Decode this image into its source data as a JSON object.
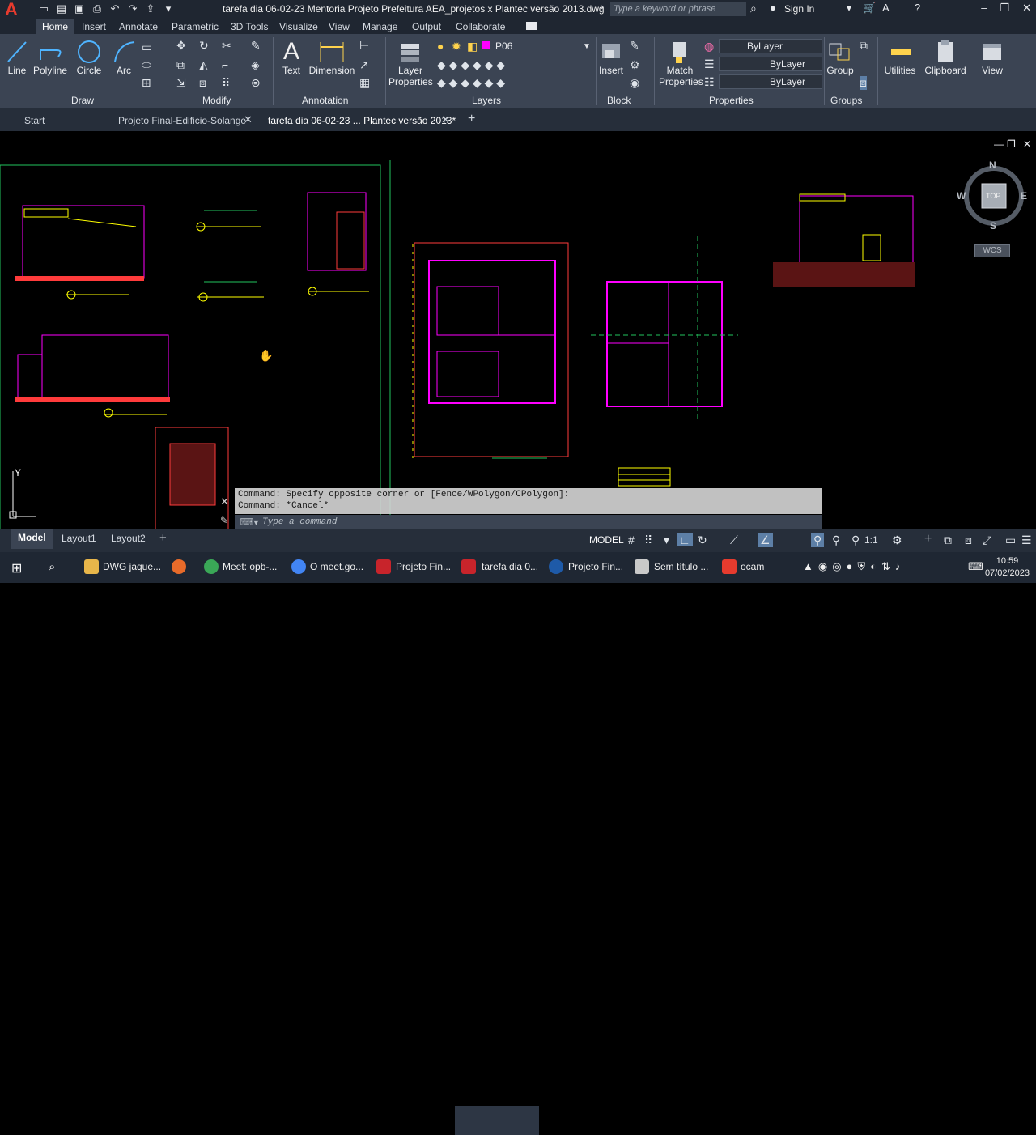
{
  "titlebar": {
    "logo": "A",
    "title": "tarefa dia 06-02-23 Mentoria Projeto Prefeitura AEA_projetos x Plantec versão 2013.dwg",
    "search_placeholder": "Type a keyword or phrase",
    "signin": "Sign In"
  },
  "ribbon_tabs": [
    "Home",
    "Insert",
    "Annotate",
    "Parametric",
    "3D Tools",
    "Visualize",
    "View",
    "Manage",
    "Output",
    "Collaborate"
  ],
  "ribbon": {
    "draw": {
      "line": "Line",
      "polyline": "Polyline",
      "circle": "Circle",
      "arc": "Arc",
      "label": "Draw"
    },
    "modify": {
      "label": "Modify"
    },
    "annotation": {
      "text": "Text",
      "dimension": "Dimension",
      "label": "Annotation"
    },
    "layers": {
      "layer_props": "Layer",
      "layer_props2": "Properties",
      "current_layer": "P06",
      "label": "Layers"
    },
    "block": {
      "insert": "Insert",
      "label": "Block"
    },
    "properties": {
      "match": "Match",
      "match2": "Properties",
      "color": "ByLayer",
      "linetype": "ByLayer",
      "lineweight": "ByLayer",
      "label": "Properties"
    },
    "groups": {
      "group": "Group",
      "label": "Groups"
    },
    "utilities": "Utilities",
    "clipboard": "Clipboard",
    "view": "View"
  },
  "file_tabs": {
    "start": "Start",
    "tab1": "Projeto Final-Edificio-Solange",
    "tab2": "tarefa dia 06-02-23 ... Plantec versão 2013*"
  },
  "viewcube": {
    "n": "N",
    "s": "S",
    "e": "E",
    "w": "W",
    "top": "TOP",
    "wcs": "WCS"
  },
  "command": {
    "line1": "Command: Specify opposite corner or [Fence/WPolygon/CPolygon]:",
    "line2": "Command: *Cancel*",
    "placeholder": "Type a command"
  },
  "status": {
    "layout_tabs": [
      "Model",
      "Layout1",
      "Layout2"
    ],
    "model_label": "MODEL",
    "scale": "1:1"
  },
  "taskbar": {
    "items": [
      "DWG jaque...",
      "Meet: opb-...",
      "O meet.go...",
      "Projeto Fin...",
      "tarefa dia 0...",
      "Projeto Fin...",
      "Sem título ...",
      "ocam"
    ],
    "time": "10:59",
    "date": "07/02/2023"
  },
  "colors": {
    "accent": "#0696d7",
    "layer": "#ff00ff",
    "ribbon": "#3b4453"
  }
}
